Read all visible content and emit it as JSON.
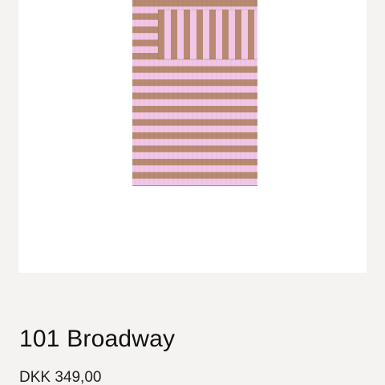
{
  "product": {
    "image_description": "striped-towel-image",
    "title": "101 Broadway",
    "price": "DKK 349,00",
    "stripe_colors": {
      "pink": "#f1c6e6",
      "tan": "#b88a72"
    }
  }
}
